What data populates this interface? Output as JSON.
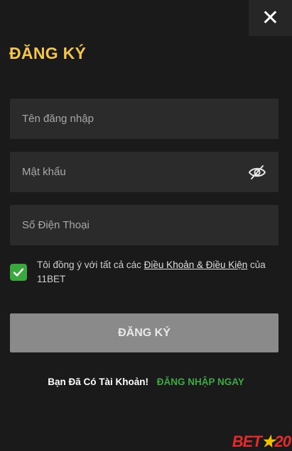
{
  "close": {
    "glyph": "✕"
  },
  "header": {
    "title": "ĐĂNG KÝ"
  },
  "form": {
    "username": {
      "placeholder": "Tên đăng nhập",
      "value": ""
    },
    "password": {
      "placeholder": "Mật khẩu",
      "value": ""
    },
    "phone": {
      "placeholder": "Số Điện Thoại",
      "value": ""
    }
  },
  "terms": {
    "checked": true,
    "prefix": "Tôi đồng ý với tất cả các ",
    "link": "Điều Khoản & Điều Kiện",
    "suffix": " của 11BET"
  },
  "submit": {
    "label": "ĐĂNG KÝ"
  },
  "login": {
    "prompt": "Bạn Đã Có Tài Khoản!",
    "link": "ĐĂNG NHẬP NGAY"
  },
  "watermark": {
    "part1": "BET",
    "star": "★",
    "part2": "20"
  },
  "colors": {
    "background": "#1a1a1a",
    "title": "#f3c64a",
    "checkbox": "#3aa83f",
    "login_link": "#3ea844",
    "submit_disabled": "#8a8a8a"
  },
  "icons": [
    "close-icon",
    "eye-slash-icon",
    "checkmark-icon"
  ]
}
